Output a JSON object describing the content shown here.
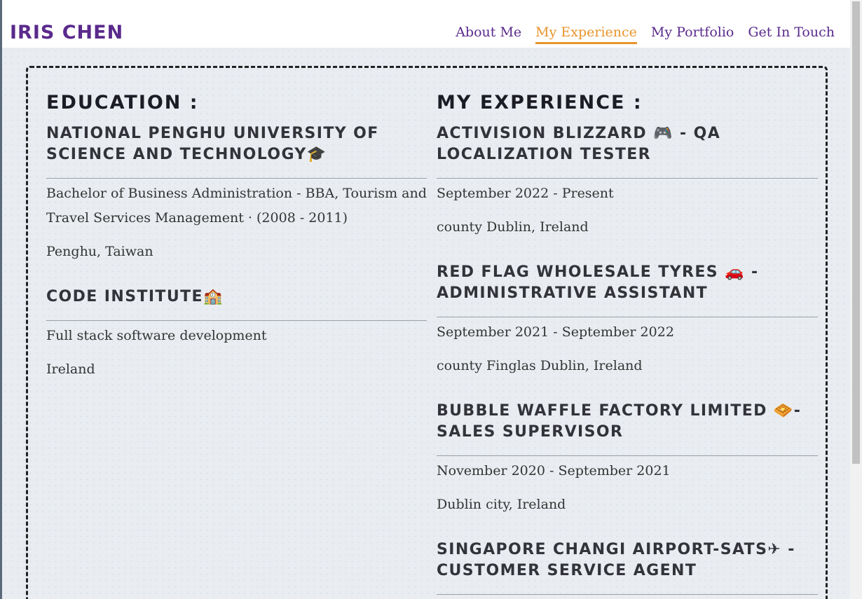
{
  "brand": "IRIS CHEN",
  "nav": [
    {
      "label": "About Me",
      "active": false
    },
    {
      "label": "My Experience",
      "active": true
    },
    {
      "label": "My Portfolio",
      "active": false
    },
    {
      "label": "Get In Touch",
      "active": false
    }
  ],
  "colors": {
    "brand": "#5a2a8c",
    "active": "#e8942c"
  },
  "education": {
    "heading": "EDUCATION :",
    "items": [
      {
        "title": "NATIONAL PENGHU UNIVERSITY OF SCIENCE AND TECHNOLOGY",
        "icon": "graduation-cap-icon",
        "icon_glyph": "🎓",
        "lines": [
          "Bachelor of Business Administration - BBA, Tourism and Travel Services Management · (2008 - 2011)",
          "Penghu, Taiwan"
        ]
      },
      {
        "title": "CODE INSTITUTE",
        "icon": "school-building-icon",
        "icon_glyph": "🏫",
        "lines": [
          "Full stack software development",
          "Ireland"
        ]
      }
    ]
  },
  "experience": {
    "heading": "MY EXPERIENCE :",
    "items": [
      {
        "title": "ACTIVISION BLIZZARD",
        "icon": "gamepad-icon",
        "icon_glyph": "🎮",
        "suffix": "- QA LOCALIZATION TESTER",
        "lines": [
          "September 2022 - Present",
          "county Dublin, Ireland"
        ]
      },
      {
        "title": "RED FLAG WHOLESALE TYRES",
        "icon": "car-icon",
        "icon_glyph": "🚗",
        "suffix": "- ADMINISTRATIVE ASSISTANT",
        "lines": [
          "September 2021 - September 2022",
          "county Finglas Dublin, Ireland"
        ]
      },
      {
        "title": "BUBBLE WAFFLE FACTORY LIMITED",
        "icon": "waffle-icon",
        "icon_glyph": "🧇",
        "suffix": "- SALES SUPERVISOR",
        "lines": [
          "November 2020 - September 2021",
          "Dublin city, Ireland"
        ]
      },
      {
        "title": "SINGAPORE CHANGI AIRPORT-SATS",
        "icon": "airplane-icon",
        "icon_glyph": "✈",
        "suffix": "- CUSTOMER SERVICE AGENT",
        "lines": []
      }
    ]
  }
}
